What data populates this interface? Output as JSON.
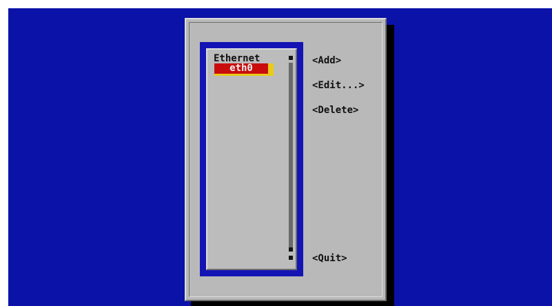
{
  "list": {
    "heading": "Ethernet",
    "items": [
      {
        "label": "eth0",
        "selected": true
      }
    ]
  },
  "buttons": {
    "add": "<Add>",
    "edit": "<Edit...>",
    "delete": "<Delete>",
    "quit": "<Quit>"
  },
  "colors": {
    "screen_background": "#0a12a8",
    "dialog_background": "#b9b9b9",
    "list_frame": "#1414b4",
    "selection_background": "#c90d0d",
    "selection_outline": "#e8cb18"
  }
}
